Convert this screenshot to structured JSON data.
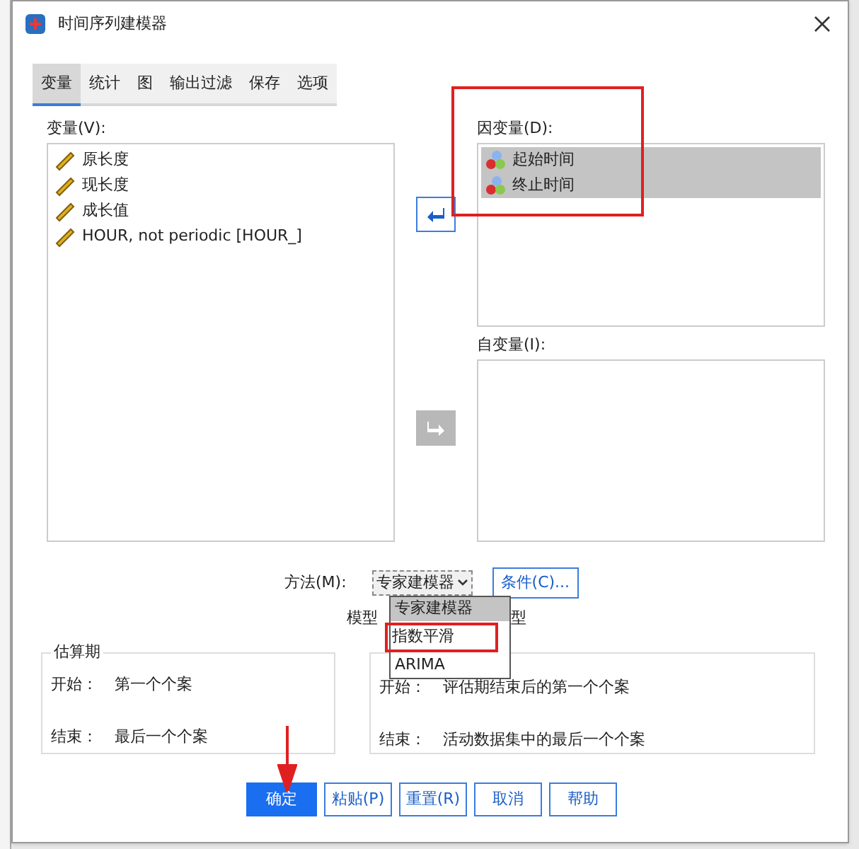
{
  "window": {
    "title": "时间序列建模器"
  },
  "tabs": [
    {
      "label": "变量",
      "selected": true
    },
    {
      "label": "统计",
      "selected": false
    },
    {
      "label": "图",
      "selected": false
    },
    {
      "label": "输出过滤",
      "selected": false
    },
    {
      "label": "保存",
      "selected": false
    },
    {
      "label": "选项",
      "selected": false
    }
  ],
  "variables": {
    "label": "变量(V):",
    "items": [
      {
        "name": "原长度",
        "kind": "scale"
      },
      {
        "name": "现长度",
        "kind": "scale"
      },
      {
        "name": "成长值",
        "kind": "scale"
      },
      {
        "name": "HOUR, not periodic [HOUR_]",
        "kind": "scale"
      }
    ]
  },
  "dependent": {
    "label": "因变量(D):",
    "items": [
      {
        "name": "起始时间",
        "kind": "nominal",
        "selected": true
      },
      {
        "name": "终止时间",
        "kind": "nominal",
        "selected": true
      }
    ]
  },
  "independent": {
    "label": "自变量(I):"
  },
  "method": {
    "label": "方法(M):",
    "value": "专家建模器",
    "options": [
      {
        "label": "专家建模器",
        "selected": true
      },
      {
        "label": "指数平滑",
        "selected": false
      },
      {
        "label": "ARIMA",
        "selected": false
      }
    ]
  },
  "criteria_button": "条件(C)...",
  "model_type": {
    "before": "模型",
    "after": "型"
  },
  "estimation": {
    "title": "估算期",
    "start_label": "开始：",
    "start": "第一个个案",
    "end_label": "结束：",
    "end": "最后一个个案"
  },
  "forecast": {
    "start_label": "开始：",
    "start": "评估期结束后的第一个个案",
    "end_label": "结束：",
    "end": "活动数据集中的最后一个个案"
  },
  "buttons": [
    {
      "label": "确定",
      "kind": "primary"
    },
    {
      "label": "粘贴(P)",
      "kind": "normal"
    },
    {
      "label": "重置(R)",
      "kind": "normal"
    },
    {
      "label": "取消",
      "kind": "normal"
    },
    {
      "label": "帮助",
      "kind": "normal"
    }
  ]
}
